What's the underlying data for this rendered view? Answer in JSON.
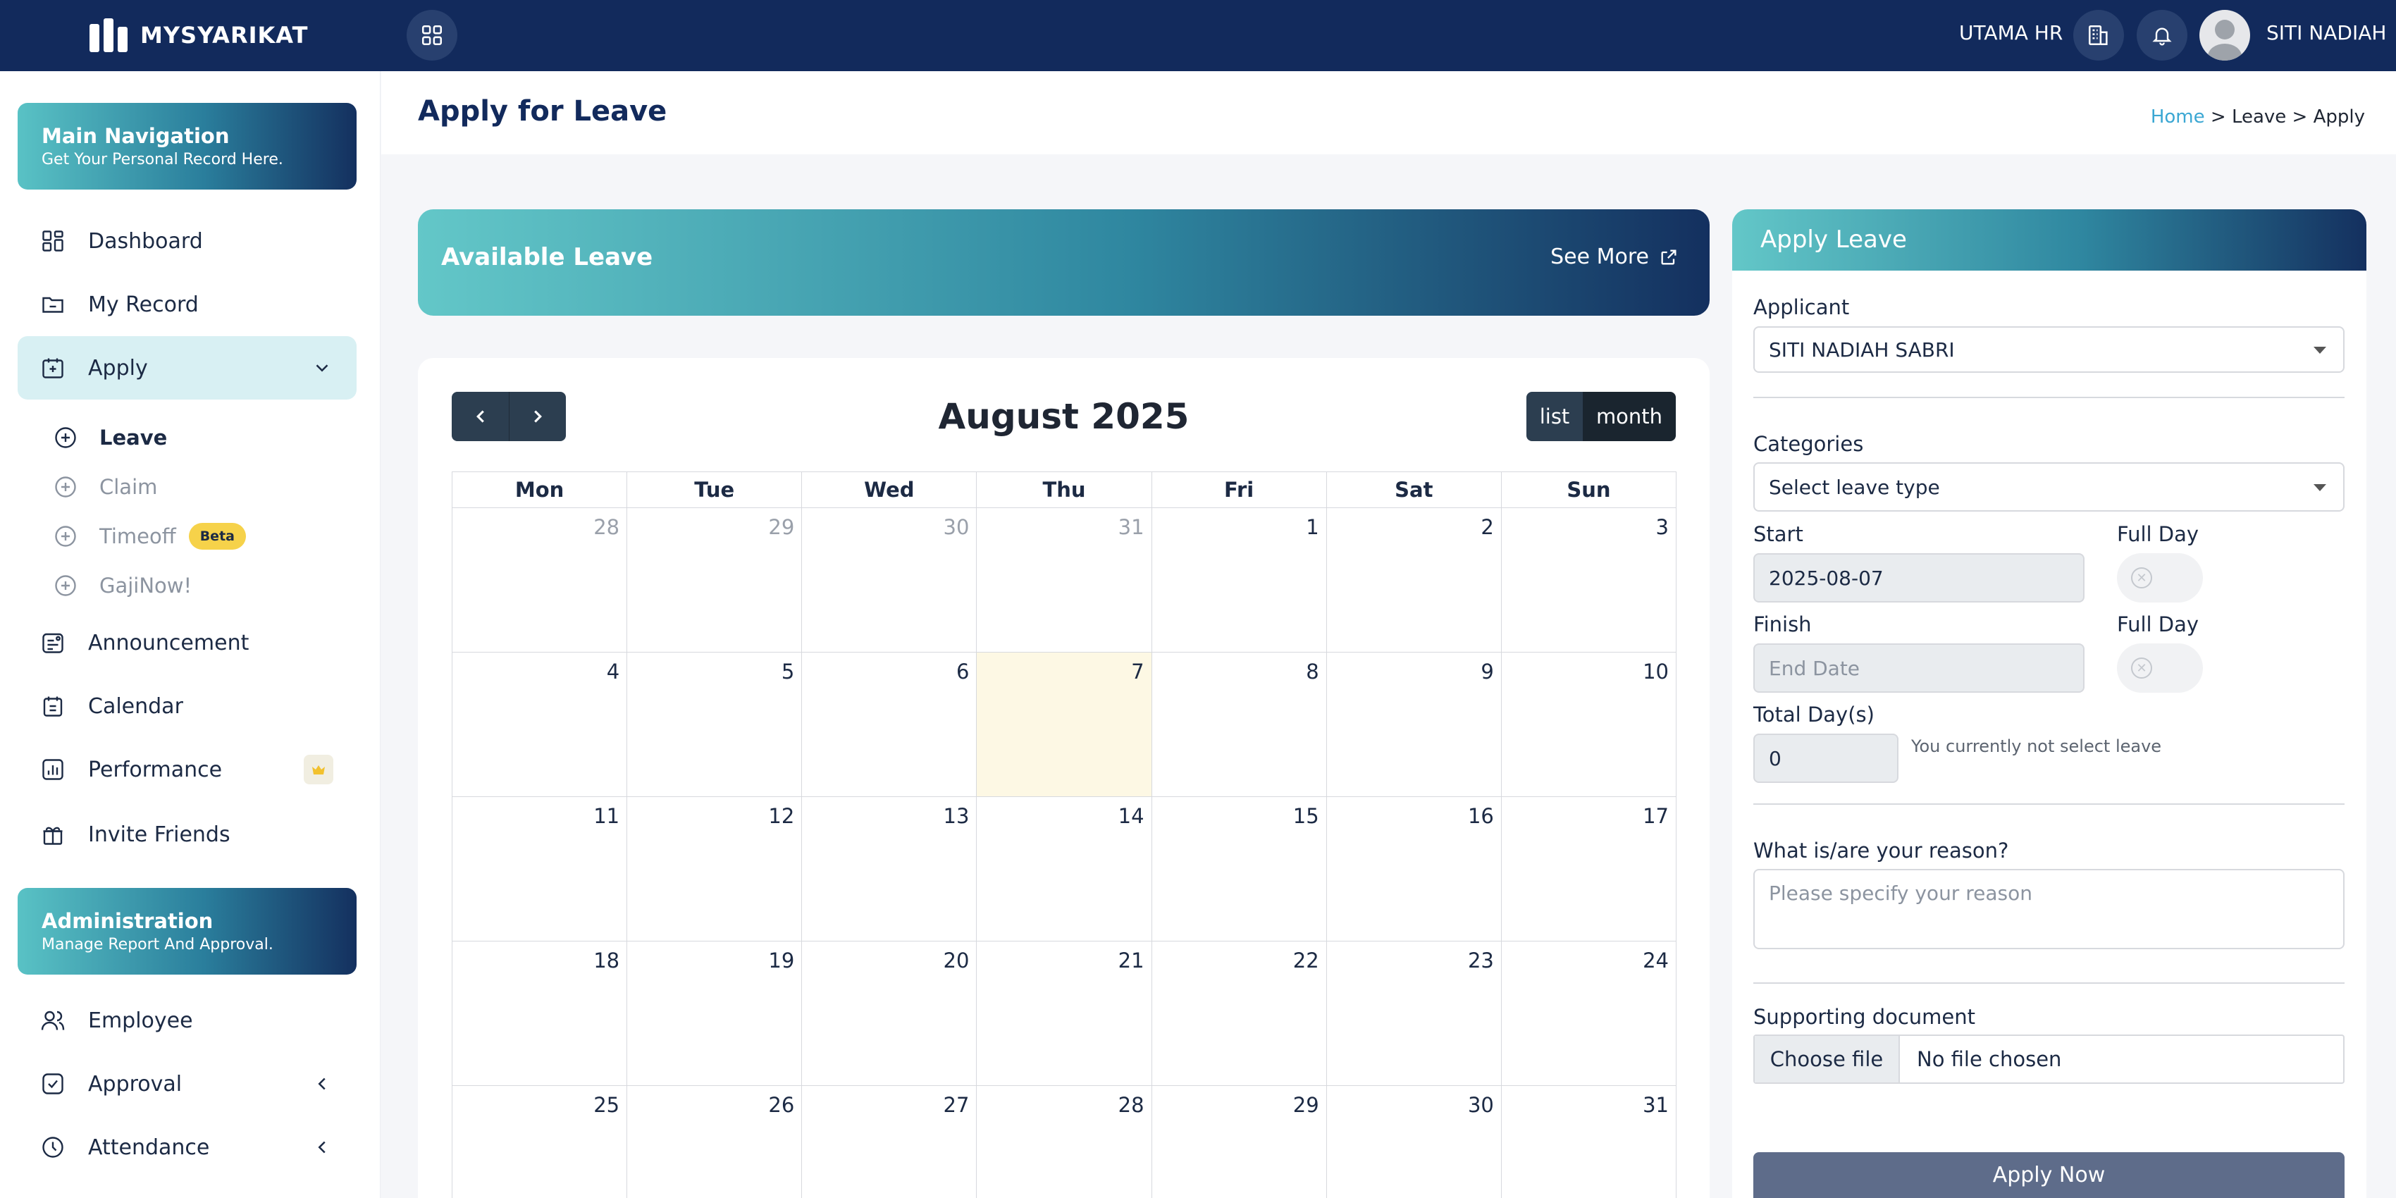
{
  "topbar": {
    "brand": "MYSYARIKAT",
    "company": "UTAMA HR",
    "username": "SITI NADIAH"
  },
  "sidebar": {
    "main_nav": {
      "title": "Main Navigation",
      "subtitle": "Get Your Personal Record Here."
    },
    "items": [
      {
        "label": "Dashboard",
        "icon": "dashboard-icon"
      },
      {
        "label": "My Record",
        "icon": "folder-icon"
      },
      {
        "label": "Apply",
        "icon": "calendar-plus-icon"
      }
    ],
    "apply_sub": [
      {
        "label": "Leave"
      },
      {
        "label": "Claim"
      },
      {
        "label": "Timeoff",
        "badge": "Beta"
      },
      {
        "label": "GajiNow!"
      }
    ],
    "more_items": [
      {
        "label": "Announcement",
        "icon": "announcement-icon"
      },
      {
        "label": "Calendar",
        "icon": "calendar-icon"
      },
      {
        "label": "Performance",
        "icon": "performance-icon"
      },
      {
        "label": "Invite Friends",
        "icon": "gift-icon"
      }
    ],
    "admin": {
      "title": "Administration",
      "subtitle": "Manage Report And Approval."
    },
    "admin_items": [
      {
        "label": "Employee",
        "icon": "users-icon"
      },
      {
        "label": "Approval",
        "icon": "check-square-icon"
      },
      {
        "label": "Attendance",
        "icon": "clock-icon"
      }
    ]
  },
  "page": {
    "title": "Apply for Leave",
    "breadcrumb": {
      "home": "Home",
      "rest": " > Leave > Apply"
    }
  },
  "available_leave": {
    "title": "Available Leave",
    "see_more": "See More"
  },
  "calendar": {
    "title": "August 2025",
    "view_list": "list",
    "view_month": "month",
    "weekdays": [
      "Mon",
      "Tue",
      "Wed",
      "Thu",
      "Fri",
      "Sat",
      "Sun"
    ],
    "weeks": [
      [
        {
          "d": "28",
          "o": true
        },
        {
          "d": "29",
          "o": true
        },
        {
          "d": "30",
          "o": true
        },
        {
          "d": "31",
          "o": true
        },
        {
          "d": "1"
        },
        {
          "d": "2"
        },
        {
          "d": "3"
        }
      ],
      [
        {
          "d": "4"
        },
        {
          "d": "5"
        },
        {
          "d": "6"
        },
        {
          "d": "7",
          "today": true
        },
        {
          "d": "8"
        },
        {
          "d": "9"
        },
        {
          "d": "10"
        }
      ],
      [
        {
          "d": "11"
        },
        {
          "d": "12"
        },
        {
          "d": "13"
        },
        {
          "d": "14"
        },
        {
          "d": "15"
        },
        {
          "d": "16"
        },
        {
          "d": "17"
        }
      ],
      [
        {
          "d": "18"
        },
        {
          "d": "19"
        },
        {
          "d": "20"
        },
        {
          "d": "21"
        },
        {
          "d": "22"
        },
        {
          "d": "23"
        },
        {
          "d": "24"
        }
      ],
      [
        {
          "d": "25"
        },
        {
          "d": "26"
        },
        {
          "d": "27"
        },
        {
          "d": "28"
        },
        {
          "d": "29"
        },
        {
          "d": "30"
        },
        {
          "d": "31"
        }
      ]
    ]
  },
  "form": {
    "title": "Apply Leave",
    "applicant_label": "Applicant",
    "applicant_value": "SITI NADIAH SABRI",
    "categories_label": "Categories",
    "categories_value": "Select leave type",
    "start_label": "Start",
    "start_value": "2025-08-07",
    "full_day_label": "Full Day",
    "finish_label": "Finish",
    "finish_placeholder": "End Date",
    "total_label": "Total Day(s)",
    "total_value": "0",
    "total_note": "You currently not select leave",
    "reason_label": "What is/are your reason?",
    "reason_placeholder": "Please specify your reason",
    "doc_label": "Supporting document",
    "choose_file": "Choose file",
    "no_file": "No file chosen",
    "submit": "Apply Now"
  }
}
